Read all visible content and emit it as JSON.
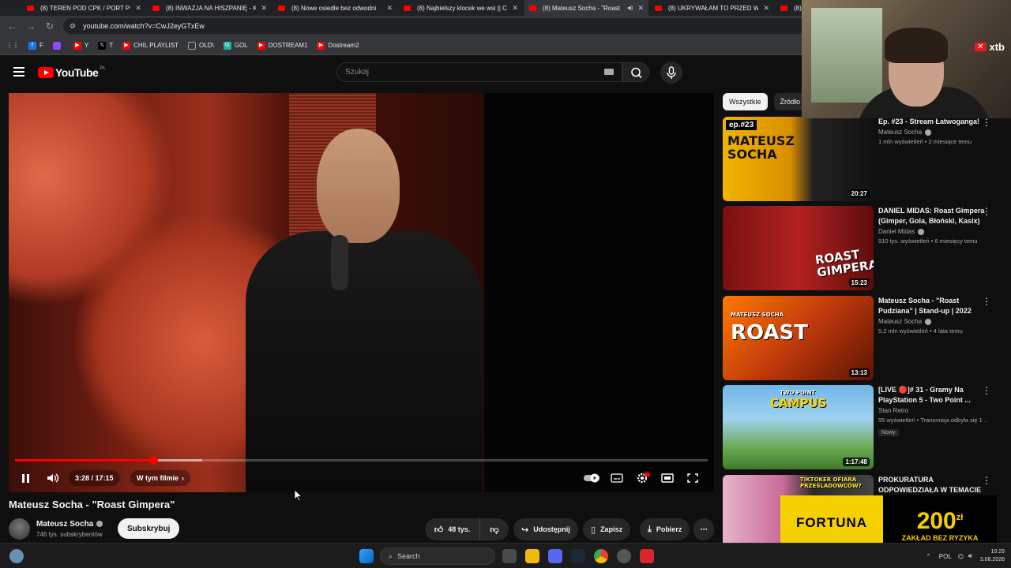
{
  "browser": {
    "tabs": [
      {
        "title": "(8) TEREN POD CPK / PORT PO"
      },
      {
        "title": "(8) INWAZJA NA HISZPANIĘ - K"
      },
      {
        "title": "(8) Nowe osiedle bez odwodni"
      },
      {
        "title": "(8) Najbielszy klocek we wsi || C"
      },
      {
        "title": "(8) Mateusz Socha - \"Roast",
        "active": true
      },
      {
        "title": "(8) UKRYWAŁAM TO PRZED W"
      },
      {
        "title": "(8) B"
      }
    ],
    "url": "youtube.com/watch?v=CwJ2eyGTxEw",
    "bookmarks": [
      {
        "label": "F",
        "icon": "facebook-icon",
        "color": "#1877f2"
      },
      {
        "label": "",
        "icon": "twitch-icon",
        "color": "#9146ff"
      },
      {
        "label": "Y",
        "icon": "youtube-icon",
        "color": "#ff0000"
      },
      {
        "label": "T",
        "icon": "x-icon",
        "color": "#000000"
      },
      {
        "label": "CHIL PLAYLIST",
        "icon": "youtube-icon",
        "color": "#ff0000"
      },
      {
        "label": "OLD\\",
        "icon": "folder-icon",
        "color": "#9aa0a6"
      },
      {
        "label": "GOL",
        "icon": "gol-icon",
        "color": "#20b2aa"
      },
      {
        "label": "DOSTREAM1",
        "icon": "youtube-icon",
        "color": "#ff0000"
      },
      {
        "label": "Dostream2",
        "icon": "youtube-icon",
        "color": "#ff0000"
      }
    ]
  },
  "youtube": {
    "logo_text": "YouTube",
    "logo_region": "PL",
    "search_placeholder": "Szukaj"
  },
  "player": {
    "time": "3:28 / 17:15",
    "played_fraction": 0.2,
    "buffered_fraction": 0.27,
    "chapter": "W tym filmie",
    "chapter_chevron": "›"
  },
  "video": {
    "title": "Mateusz Socha - \"Roast Gimpera\"",
    "channel": "Mateusz Socha",
    "subscribers": "746 tys. subskrybentów",
    "subscribe": "Subskrybuj",
    "likes": "48 tys.",
    "share": "Udostępnij",
    "save": "Zapisz",
    "download": "Pobierz"
  },
  "sidebar": {
    "chips": [
      "Wszystkie",
      "Źródło"
    ],
    "recommendations": [
      {
        "title": "Ep. #23 - Stream Łatwoganga!",
        "channel": "Mateusz Socha",
        "stats": "1 mln wyświetleń • 2 miesiące temu",
        "duration": "20:27",
        "thumb_big": "MATEUSZ SOCHA",
        "thumb_small": "ep.#23",
        "badge": ""
      },
      {
        "title": "DANIEL MIDAS: Roast Gimpera (Gimper, Gola, Błoński, Kasix) |...",
        "channel": "Daniel Midas",
        "stats": "910 tys. wyświetleń • 6 miesięcy temu",
        "duration": "15:23",
        "thumb_big": "ROAST GIMPERA",
        "thumb_small": "",
        "badge": ""
      },
      {
        "title": "Mateusz Socha - \"Roast Pudziana\" | Stand-up | 2022",
        "channel": "Mateusz Socha",
        "stats": "5,2 mln wyświetleń • 4 lata temu",
        "duration": "13:13",
        "thumb_big": "ROAST",
        "thumb_small": "MATEUSZ SOCHA",
        "badge": ""
      },
      {
        "title": "[LIVE 🔴]# 31 - Gramy Na PlayStation 5 - Two Point ...",
        "channel": "Stan Retro",
        "stats": "55 wyświetleń • Transmisja odbyła się 1 ...",
        "duration": "1:17:48",
        "thumb_big": "CAMPUS",
        "thumb_small": "TWO POINT",
        "badge": "Nowy"
      },
      {
        "title": "PROKURATURA ODPOWIEDZIAŁA W TEMACIE ...",
        "channel": "",
        "stats": "",
        "duration": "",
        "thumb_big": "TIKTOKER OFIARA PRZEŚLADOWCÓW?",
        "thumb_small": "",
        "badge": ""
      }
    ]
  },
  "overlays": {
    "xtb": "xtb",
    "fortuna_brand": "FORTUNA",
    "fortuna_amount": "200",
    "fortuna_currency": "zł",
    "fortuna_note": "ZAKŁAD BEZ RYZYKA"
  },
  "taskbar": {
    "search": "Search",
    "lang": "POL",
    "time": "10:29",
    "date": "3.08.2026"
  }
}
